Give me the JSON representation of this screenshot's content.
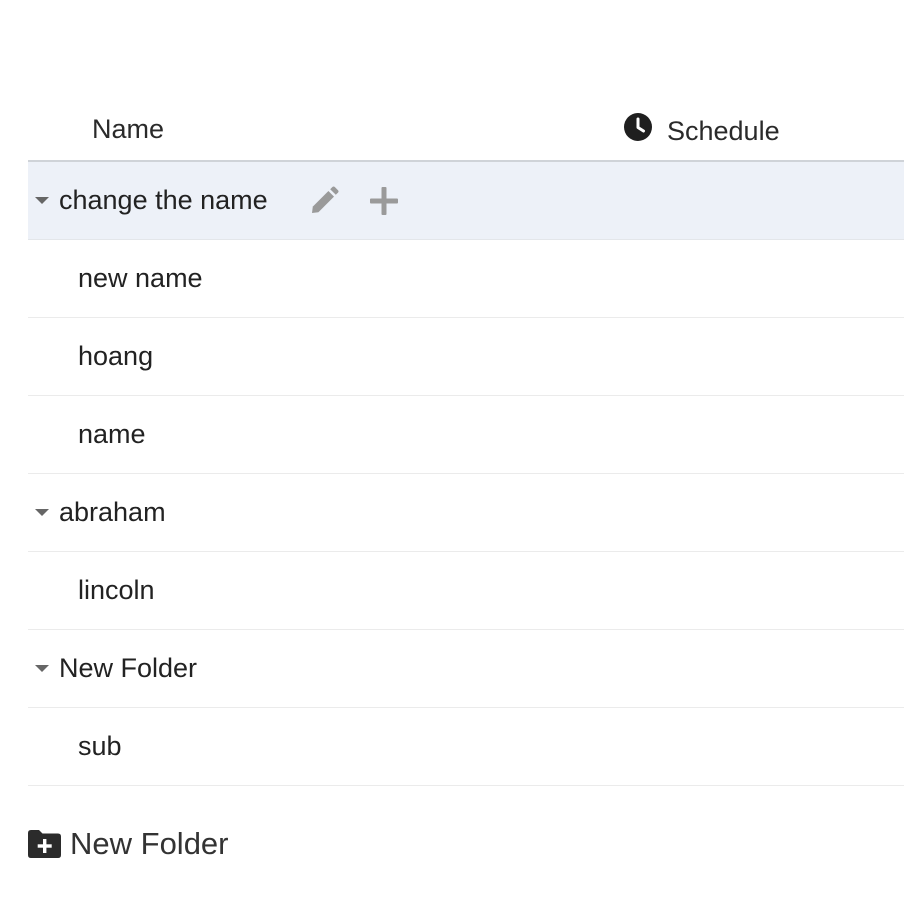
{
  "header": {
    "name_label": "Name",
    "schedule_label": "Schedule",
    "schedule_icon": "clock-icon"
  },
  "rows": [
    {
      "label": "change the name",
      "type": "folder",
      "expanded": true,
      "selected": true
    },
    {
      "label": "new name",
      "type": "item"
    },
    {
      "label": "hoang",
      "type": "item"
    },
    {
      "label": "name",
      "type": "item"
    },
    {
      "label": "abraham",
      "type": "folder",
      "expanded": true
    },
    {
      "label": "lincoln",
      "type": "item"
    },
    {
      "label": "New Folder",
      "type": "folder",
      "expanded": true
    },
    {
      "label": "sub",
      "type": "item"
    }
  ],
  "row_actions": {
    "edit_icon": "pencil-icon",
    "add_icon": "plus-icon"
  },
  "footer": {
    "new_folder_label": "New Folder",
    "new_folder_icon": "folder-plus-icon"
  },
  "colors": {
    "selected_row_bg": "#edf1f8",
    "icon_gray": "#9a9a9a",
    "header_border": "#cfd3d8"
  }
}
